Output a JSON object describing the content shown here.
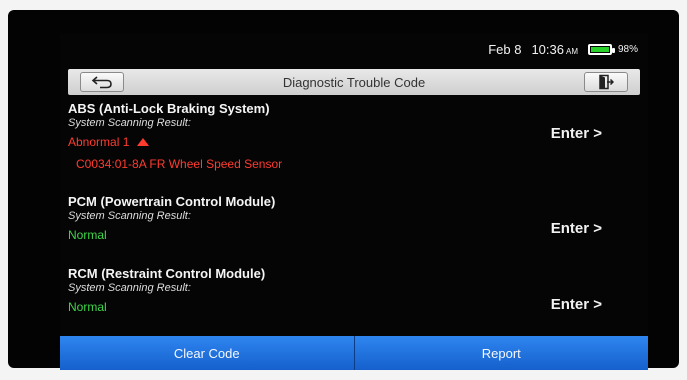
{
  "status": {
    "date": "Feb 8",
    "time": "10:36",
    "ampm": "AM",
    "battery": "98%",
    "battery_level": 0.98
  },
  "header": {
    "title": "Diagnostic Trouble Code",
    "back_icon": "back-arrow-icon",
    "exit_icon": "exit-door-icon"
  },
  "modules": [
    {
      "name": "ABS (Anti-Lock Braking System)",
      "subtitle": "System Scanning Result:",
      "status": "Abnormal 1",
      "status_color": "#ff3b30",
      "dtc": "C0034:01-8A FR Wheel Speed Sensor",
      "enter": "Enter >"
    },
    {
      "name": "PCM (Powertrain Control Module)",
      "subtitle": "System Scanning Result:",
      "status": "Normal",
      "status_color": "#3fd64a",
      "enter": "Enter >"
    },
    {
      "name": "RCM (Restraint Control Module)",
      "subtitle": "System Scanning Result:",
      "status": "Normal",
      "status_color": "#3fd64a",
      "enter": "Enter >"
    }
  ],
  "actions": {
    "clear_code": "Clear Code",
    "report": "Report"
  },
  "colors": {
    "accent": "#1a6bd6",
    "error": "#ff3b30",
    "ok": "#3fd64a"
  }
}
